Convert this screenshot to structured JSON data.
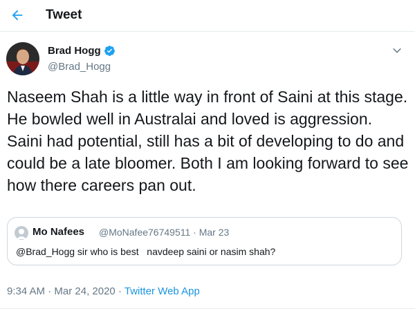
{
  "header": {
    "title": "Tweet",
    "back_icon": "arrow-left-icon",
    "accent": "#1da1f2"
  },
  "author": {
    "name": "Brad Hogg",
    "handle": "@Brad_Hogg",
    "verified": true
  },
  "tweet": {
    "text": "Naseem Shah is a little way in front of Saini at this stage. He bowled well in Australai and loved is aggression. Saini had potential, still has a bit of developing to do and could be a late bloomer. Both I am looking forward to see how there careers pan out."
  },
  "quoted": {
    "name": "Mo Nafees",
    "handle": "@MoNafee76749511",
    "separator": "·",
    "date": "Mar 23",
    "text": "@Brad_Hogg sir who is best   navdeep saini or nasim shah?"
  },
  "footer": {
    "time": "9:34 AM",
    "separator1": "·",
    "date": "Mar 24, 2020",
    "separator2": "·",
    "app": "Twitter Web App",
    "link_color": "#1b95e0"
  }
}
